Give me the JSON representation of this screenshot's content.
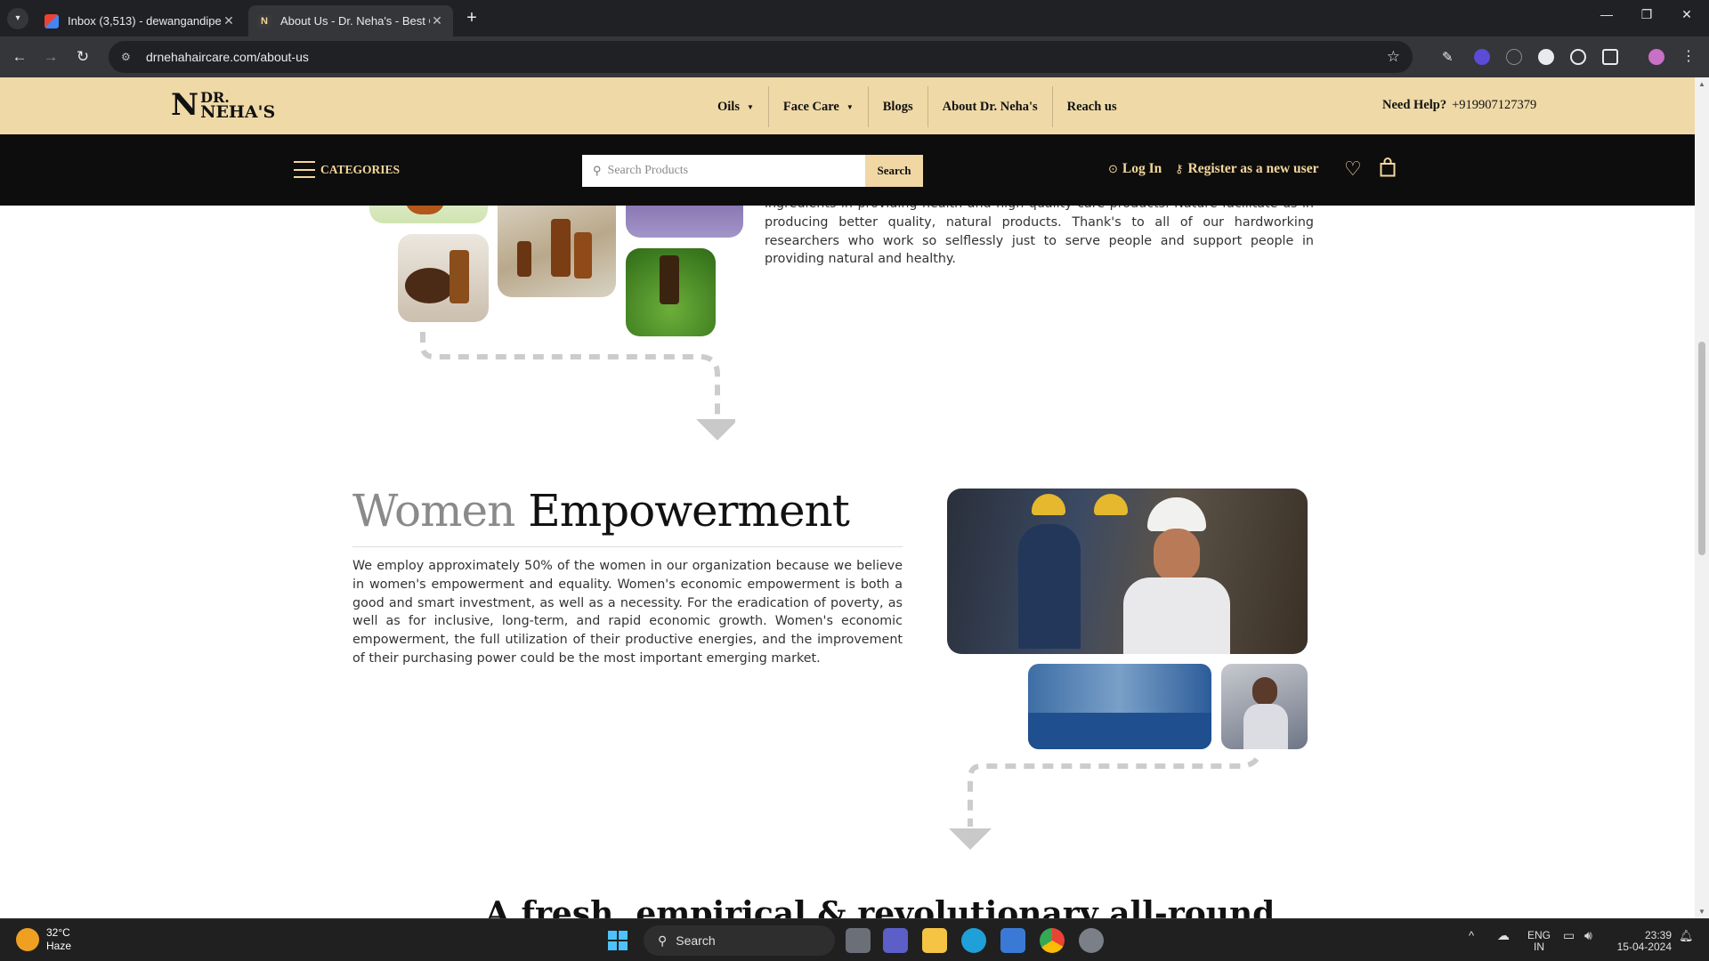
{
  "browser": {
    "tabs": [
      {
        "title": "Inbox (3,513) - dewangandipen",
        "active": false
      },
      {
        "title": "About Us - Dr. Neha's - Best Ca",
        "active": true
      }
    ],
    "url": "drnehahaircare.com/about-us"
  },
  "site": {
    "logo_mark": "N",
    "logo_line1": "DR.",
    "logo_line2": "NEHA'S",
    "nav": [
      {
        "label": "Oils",
        "has_dropdown": true
      },
      {
        "label": "Face Care",
        "has_dropdown": true
      },
      {
        "label": "Blogs",
        "has_dropdown": false
      },
      {
        "label": "About Dr. Neha's",
        "has_dropdown": false
      },
      {
        "label": "Reach us",
        "has_dropdown": false
      }
    ],
    "help_label": "Need Help?",
    "help_phone": "+919907127379",
    "categories_label": "CATEGORIES",
    "search_placeholder": "Search Products",
    "search_button": "Search",
    "login_label": "Log In",
    "register_label": "Register as a new user"
  },
  "about": {
    "intro_text": "ingredients in providing health and high quality care products. Nature facilitate us in producing better quality, natural products. Thank's to all of our hardworking researchers who work so selflessly just to serve people and support people in providing natural and healthy.",
    "heading_light": "Women",
    "heading_dark": "Empowerment",
    "women_text": "We employ approximately 50% of the women in our organization because we believe in women's empowerment and equality. Women's economic empowerment is both a good and smart investment, as well as a necessity. For the eradication of poverty, as well as for inclusive, long-term, and rapid economic growth. Women's economic empowerment, the full utilization of their productive energies, and the improvement of their purchasing power could be the most important emerging market.",
    "next_heading_peek": "A fresh, empirical & revolutionary all-round"
  },
  "taskbar": {
    "temperature": "32°C",
    "weather": "Haze",
    "search_label": "Search",
    "lang_line1": "ENG",
    "lang_line2": "IN",
    "time": "23:39",
    "date": "15-04-2024"
  },
  "colors": {
    "header_bg": "#efd9a7",
    "bar_bg": "#0d0d0d",
    "accent_gold": "#f3d79b"
  }
}
